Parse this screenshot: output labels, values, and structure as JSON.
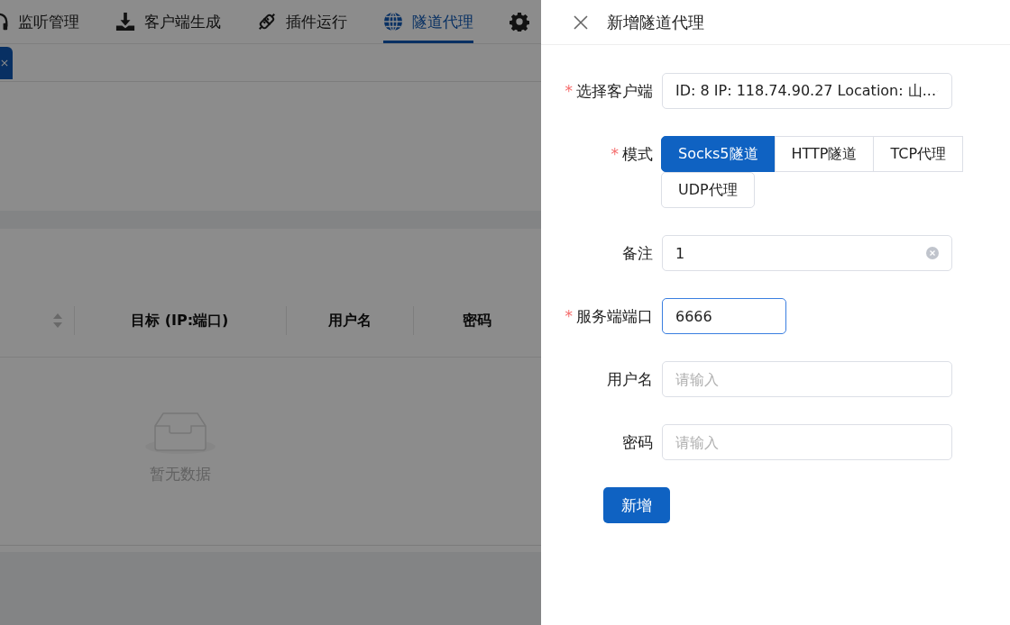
{
  "nav_tabs": [
    {
      "label": "监听管理",
      "selected": false
    },
    {
      "label": "客户端生成",
      "selected": false
    },
    {
      "label": "插件运行",
      "selected": false
    },
    {
      "label": "隧道代理",
      "selected": true
    }
  ],
  "table": {
    "columns": [
      "目标 (IP:端口)",
      "用户名",
      "密码"
    ],
    "empty_text": "暂无数据"
  },
  "drawer": {
    "title": "新增隧道代理",
    "fields": [
      {
        "kind": "select",
        "label": "选择客户端",
        "required_mark": "*",
        "value": "ID: 8 IP: 118.74.90.27 Location: 山..."
      },
      {
        "kind": "radio",
        "label": "模式",
        "required_mark": "*",
        "options": [
          {
            "label": "Socks5隧道",
            "selected": true
          },
          {
            "label": "HTTP隧道",
            "selected": false
          },
          {
            "label": "TCP代理",
            "selected": false
          },
          {
            "label": "UDP代理",
            "selected": false
          }
        ]
      },
      {
        "kind": "input",
        "label": "备注",
        "value": "1",
        "clearable": true,
        "focused": false
      },
      {
        "kind": "input",
        "label": "服务端端口",
        "required_mark": "*",
        "value": "6666",
        "focused": true,
        "short": true
      },
      {
        "kind": "input",
        "label": "用户名",
        "placeholder": "请输入",
        "focused": false
      },
      {
        "kind": "input",
        "label": "密码",
        "placeholder": "请输入",
        "focused": false
      }
    ],
    "submit": "新增"
  }
}
